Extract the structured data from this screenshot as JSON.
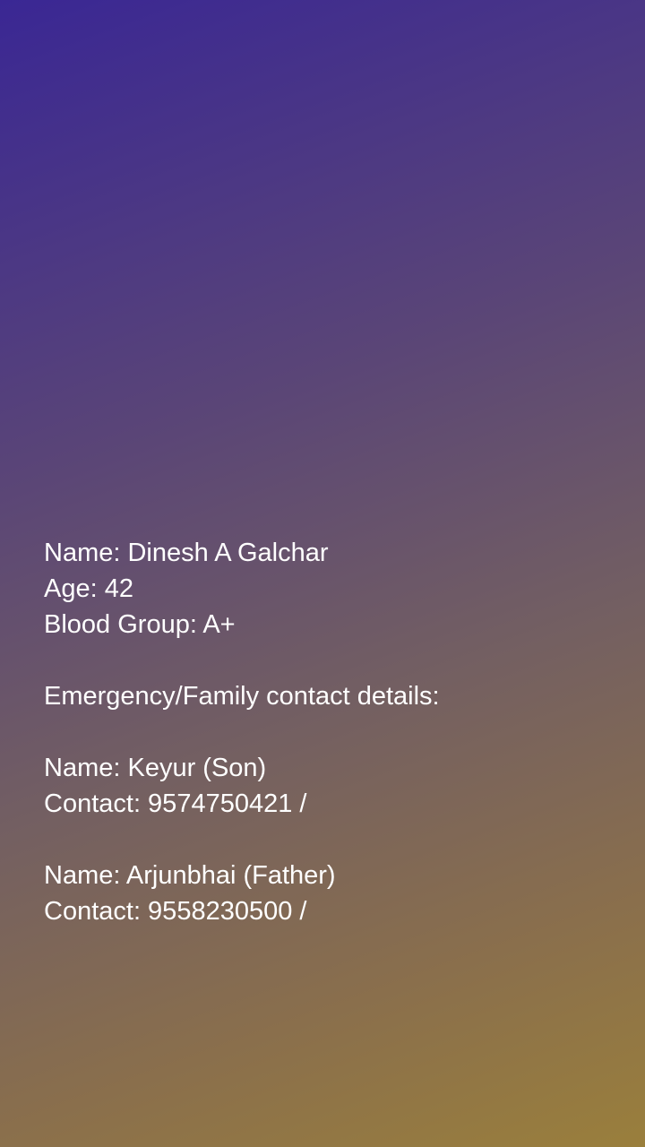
{
  "colors": {
    "gradient_top_left": "#3a2794",
    "gradient_bottom_right": "#9a7f3c",
    "text": "#ffffff"
  },
  "person": {
    "name_line": "Name: Dinesh A Galchar",
    "age_line": "Age: 42",
    "blood_group_line": "Blood Group: A+"
  },
  "emergency": {
    "heading": "Emergency/Family contact details:",
    "contacts": [
      {
        "name_line": "Name: Keyur (Son)",
        "contact_line": "Contact: 9574750421 /"
      },
      {
        "name_line": "Name: Arjunbhai (Father)",
        "contact_line": "Contact: 9558230500 /"
      }
    ]
  }
}
